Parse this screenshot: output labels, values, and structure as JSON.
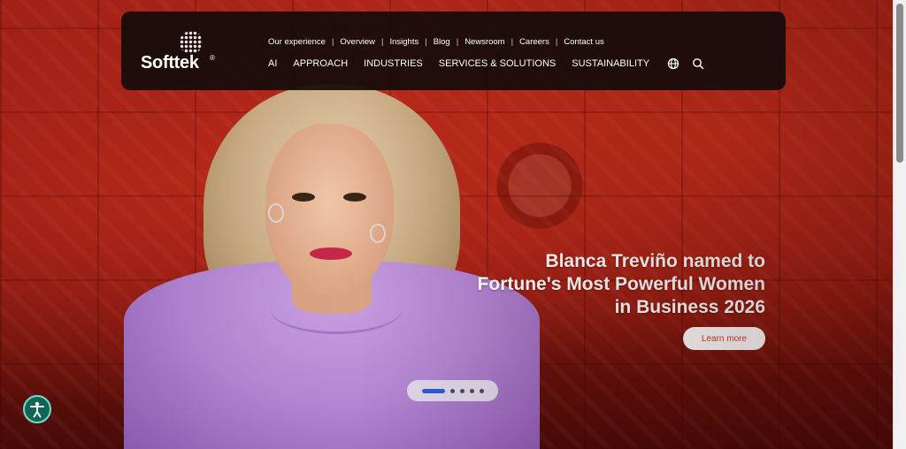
{
  "brand": {
    "name": "Softtek",
    "registered": "®"
  },
  "top_links": [
    "Our experience",
    "Overview",
    "Insights",
    "Blog",
    "Newsroom",
    "Careers",
    "Contact us"
  ],
  "top_links_separator": "|",
  "main_nav": [
    "AI",
    "APPROACH",
    "INDUSTRIES",
    "SERVICES & SOLUTIONS",
    "SUSTAINABILITY"
  ],
  "nav_icons": [
    "globe-icon",
    "search-icon"
  ],
  "hero": {
    "headline_lines": [
      "Blanca Treviño named to",
      "Fortune's Most Powerful Women",
      "in Business 2026"
    ],
    "cta_label": "Learn more"
  },
  "slider": {
    "total": 5,
    "active_index": 0
  },
  "accessibility_icon": "accessibility-icon",
  "colors": {
    "accent_blue": "#2a5bd7",
    "cta_text": "#d33a2c",
    "navbar_bg": "#160c0c",
    "a11y_bg": "#0f6b5a"
  }
}
